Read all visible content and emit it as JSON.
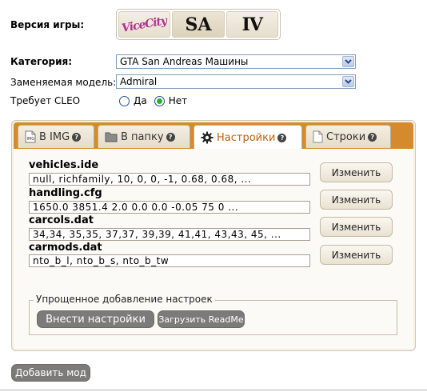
{
  "game_version": {
    "label": "Версия игры:",
    "options": [
      {
        "name": "Vice City",
        "logo": "vice-city-logo"
      },
      {
        "name": "San Andreas",
        "logo": "SA"
      },
      {
        "name": "GTA IV",
        "logo": "IV"
      }
    ],
    "vc_text": "ViceCity",
    "sa_text": "SA",
    "iv_text": "IV"
  },
  "category": {
    "label": "Категория:",
    "value": "GTA San Andreas Машины"
  },
  "replaced_model": {
    "label": "Заменяемая модель:",
    "value": "Admiral"
  },
  "cleo": {
    "label": "Требует CLEO",
    "yes": "Да",
    "no": "Нет",
    "selected": "no"
  },
  "tabs": [
    {
      "label": "В IMG",
      "icon": "img-file-icon",
      "help": "?"
    },
    {
      "label": "В папку",
      "icon": "folder-icon",
      "help": "?"
    },
    {
      "label": "Настройки",
      "icon": "gear-icon",
      "help": "?",
      "active": true
    },
    {
      "label": "Строки",
      "icon": "document-icon",
      "help": "?"
    }
  ],
  "files": [
    {
      "name": "vehicles.ide",
      "value": "null, richfamily, 10, 0, 0, -1, 0.68, 0.68, ...",
      "button": "Изменить"
    },
    {
      "name": "handling.cfg",
      "value": "1650.0 3851.4 2.0 0.0 0.0 -0.05 75 0 ...",
      "button": "Изменить"
    },
    {
      "name": "carcols.dat",
      "value": "34,34, 35,35, 37,37, 39,39, 41,41, 43,43, 45, ...",
      "button": "Изменить"
    },
    {
      "name": "carmods.dat",
      "value": "nto_b_l, nto_b_s, nto_b_tw",
      "button": "Изменить"
    }
  ],
  "simplified": {
    "legend": "Упрощенное добавление настроек",
    "apply_button": "Внести настройки",
    "readme_button": "Загрузить ReadMe"
  },
  "add_mod_button": "Добавить мод",
  "colors": {
    "tab_bar": "#d58a2d",
    "active_tab_text": "#b96313",
    "panel_bg": "#f3f0e8",
    "pill_bg": "#7d7b79"
  }
}
